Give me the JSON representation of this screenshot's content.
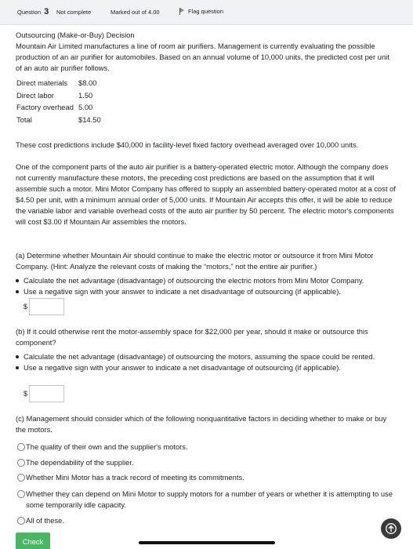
{
  "header": {
    "question_label": "Question",
    "question_number": "3",
    "status": "Not complete",
    "marks": "Marked out of 4.00",
    "flag_label": "Flag question"
  },
  "intro": {
    "title": "Outsourcing (Make-or-Buy) Decision",
    "body": "Mountain Air Limited manufactures a line of room air purifiers. Management is currently evaluating the possible production of an air purifier for automobiles. Based on an annual volume of 10,000 units, the predicted cost per unit of an auto air purifier follows."
  },
  "costs": [
    {
      "label": "Direct materials",
      "value": "$8.00"
    },
    {
      "label": "Direct labor",
      "value": "1.50"
    },
    {
      "label": "Factory overhead",
      "value": "5.00"
    },
    {
      "label": "Total",
      "value": "$14.50"
    }
  ],
  "para_fixed": "These cost predictions include $40,000 in facility-level fixed factory overhead averaged over 10,000 units.",
  "para_motor": "One of the component parts of the auto air purifier is a battery-operated electric motor. Although the company does not currently manufacture these motors, the preceding cost predictions are based on the assumption that it will assemble such a motor. Mini Motor Company has offered to supply an assembled battery-operated motor at a cost of $4.50 per unit, with a minimum annual order of 5,000 units. If Mountain Air accepts this offer, it will be able to reduce the variable labor and variable overhead costs of the auto air purifier by 50 percent. The electric motor's components will cost $3.00 if Mountain Air assembles the motors.",
  "part_a": {
    "question": "(a) Determine whether Mountain Air should continue to make the electric motor or outsource it from Mini Motor Company. (Hint: Analyze the relevant costs of making the “motors,” not the entire air purifier.)",
    "bullet1": "Calculate the net advantage (disadvantage) of outsourcing the electric motors from Mini Motor Company.",
    "bullet2": "Use a negative sign with your answer to indicate a net disadvantage of outsourcing (if applicable).",
    "currency": "$",
    "value": ""
  },
  "part_b": {
    "question": "(b) If it could otherwise rent the motor-assembly space for $22,000 per year, should it make or outsource this component?",
    "bullet1": "Calculate the net advantage (disadvantage) of outsourcing the motors, assuming the space could be rented.",
    "bullet2": "Use a negative sign with your answer to indicate a net disadvantage of outsourcing (if applicable).",
    "currency": "$",
    "value": ""
  },
  "part_c": {
    "question": "(c) Management should consider which of the following nonquantitative factors in deciding whether to make or buy the motors.",
    "options": [
      "The quality of their own and the supplier's motors.",
      "The dependability of the supplier.",
      "Whether Mini Motor has a track record of meeting its commitments.",
      "Whether they can depend on Mini Motor to supply motors for a number of years or whether it is attempting to use some temporarily idle capacity.",
      "All of these."
    ]
  },
  "check_label": "Check",
  "icons": {
    "flag": "flag-icon",
    "scroll_top": "arrow-up-icon"
  },
  "colors": {
    "check_button": "#4ab563",
    "header_bg": "#f0f2f4"
  }
}
